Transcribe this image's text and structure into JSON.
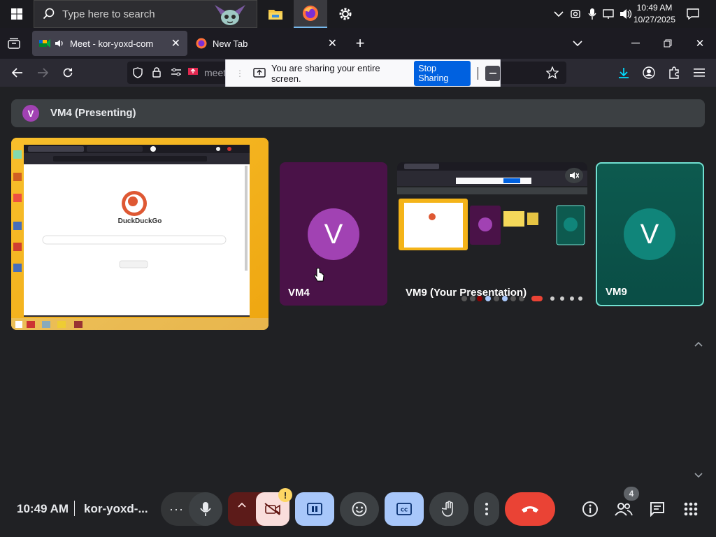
{
  "taskbar": {
    "search_placeholder": "Type here to search",
    "clock_time": "10:49 AM",
    "clock_date": "10/27/2025"
  },
  "browser": {
    "tabs": [
      {
        "label": "Meet - kor-yoxd-com"
      },
      {
        "label": "New Tab"
      }
    ],
    "url_partial": "meet.g",
    "share_bar": {
      "message": "You are sharing your entire screen.",
      "stop_label": "Stop Sharing"
    }
  },
  "meet": {
    "presenting_banner": {
      "avatar_letter": "V",
      "label": "VM4 (Presenting)"
    },
    "shared_screen": {
      "inner_brand": "DuckDuckGo"
    },
    "tiles": [
      {
        "name": "VM4",
        "avatar_letter": "V",
        "color": "#4a1248",
        "avatar_color": "#a142b3"
      },
      {
        "name": "VM9 (Your Presentation)"
      },
      {
        "name": "VM9",
        "avatar_letter": "V",
        "color": "#0d5a4f",
        "avatar_color": "#10857a"
      }
    ],
    "bottom": {
      "time": "10:49 AM",
      "meeting_code": "kor-yoxd-...",
      "people_count": "4",
      "warning_badge": "!"
    }
  },
  "colors": {
    "meet_bg": "#202124",
    "end_call": "#ea4335",
    "accent_blue": "#a8c7fa",
    "cam_off_red": "#5c1b19",
    "share_blue": "#0061e0"
  }
}
